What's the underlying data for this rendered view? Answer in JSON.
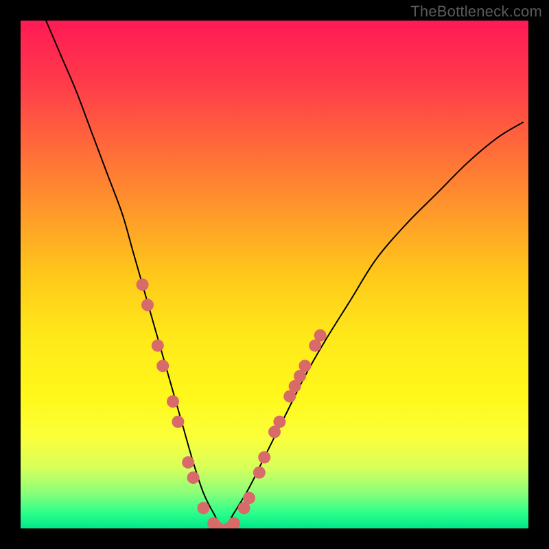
{
  "watermark": "TheBottleneck.com",
  "chart_data": {
    "type": "line",
    "title": "",
    "xlabel": "",
    "ylabel": "",
    "xlim": [
      0,
      100
    ],
    "ylim": [
      0,
      100
    ],
    "grid": false,
    "legend": false,
    "series": [
      {
        "name": "curve",
        "x": [
          5,
          8,
          11,
          14,
          17,
          20,
          22,
          24,
          26,
          28,
          30,
          32,
          34,
          36,
          38,
          40,
          42,
          45,
          48,
          52,
          56,
          60,
          65,
          70,
          76,
          82,
          88,
          94,
          99
        ],
        "y": [
          100,
          93,
          86,
          78,
          70,
          62,
          55,
          48,
          41,
          34,
          27,
          20,
          13,
          7,
          3,
          0,
          3,
          8,
          14,
          22,
          30,
          37,
          45,
          53,
          60,
          66,
          72,
          77,
          80
        ]
      }
    ],
    "annotations": {
      "marker_color": "#d86a6a",
      "marker_points": [
        {
          "x": 24,
          "y": 48
        },
        {
          "x": 25,
          "y": 44
        },
        {
          "x": 27,
          "y": 36
        },
        {
          "x": 28,
          "y": 32
        },
        {
          "x": 30,
          "y": 25
        },
        {
          "x": 31,
          "y": 21
        },
        {
          "x": 33,
          "y": 13
        },
        {
          "x": 34,
          "y": 10
        },
        {
          "x": 36,
          "y": 4
        },
        {
          "x": 38,
          "y": 1
        },
        {
          "x": 39,
          "y": 0
        },
        {
          "x": 41,
          "y": 0
        },
        {
          "x": 42,
          "y": 1
        },
        {
          "x": 44,
          "y": 4
        },
        {
          "x": 45,
          "y": 6
        },
        {
          "x": 47,
          "y": 11
        },
        {
          "x": 48,
          "y": 14
        },
        {
          "x": 50,
          "y": 19
        },
        {
          "x": 51,
          "y": 21
        },
        {
          "x": 53,
          "y": 26
        },
        {
          "x": 54,
          "y": 28
        },
        {
          "x": 55,
          "y": 30
        },
        {
          "x": 56,
          "y": 32
        },
        {
          "x": 58,
          "y": 36
        },
        {
          "x": 59,
          "y": 38
        }
      ]
    }
  }
}
